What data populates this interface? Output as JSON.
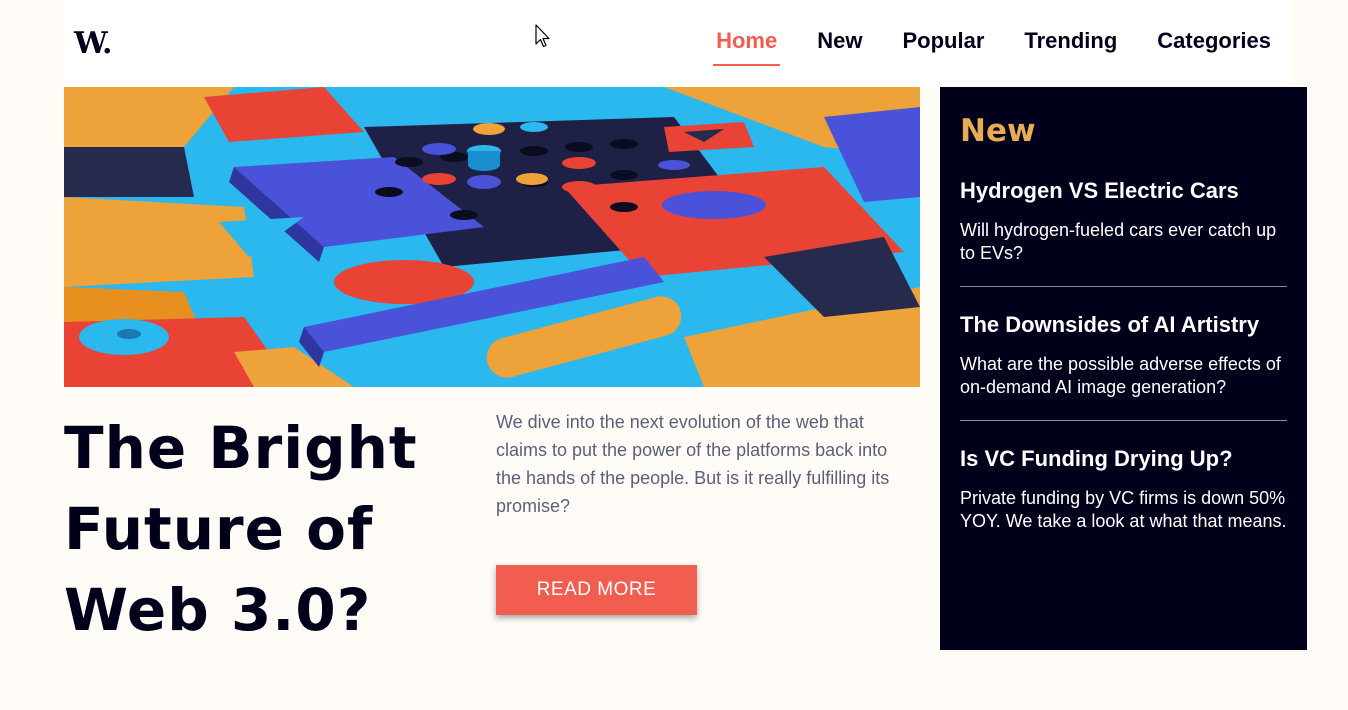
{
  "logo": {
    "text": "W."
  },
  "nav": {
    "items": [
      {
        "label": "Home",
        "active": true
      },
      {
        "label": "New",
        "active": false
      },
      {
        "label": "Popular",
        "active": false
      },
      {
        "label": "Trending",
        "active": false
      },
      {
        "label": "Categories",
        "active": false
      }
    ]
  },
  "main": {
    "headline": "The Bright Future of Web 3.0?",
    "summary": "We dive into the next evolution of the web that claims to put the power of the platforms back into the hands of the people. But is it really fulfilling its promise?",
    "read_more_label": "READ MORE"
  },
  "sidebar": {
    "heading": "New",
    "items": [
      {
        "title": "Hydrogen VS Electric Cars",
        "description": "Will hydrogen-fueled cars ever catch up to EVs?"
      },
      {
        "title": "The Downsides of AI Artistry",
        "description": "What are the possible adverse effects of on-demand AI image generation?"
      },
      {
        "title": "Is VC Funding Drying Up?",
        "description": "Private funding by VC firms is down 50% YOY. We take a look at what that means."
      }
    ]
  },
  "colors": {
    "accent": "#f15e50",
    "dark": "#00001a",
    "gold": "#e9ab53",
    "background": "#fffcf8"
  }
}
